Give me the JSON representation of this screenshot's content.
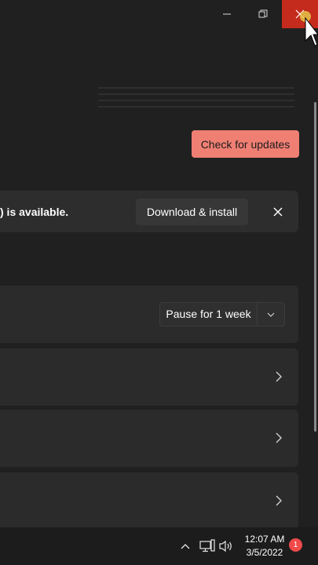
{
  "window": {
    "minimize_icon": "minimize-icon",
    "restore_icon": "restore-icon",
    "close_icon": "close-icon"
  },
  "header": {
    "check_updates_label": "Check for updates",
    "accent_color": "#f07f73"
  },
  "update_banner": {
    "text": ") is available.",
    "download_label": "Download & install",
    "dismiss_icon": "close-icon"
  },
  "pause": {
    "selected": "Pause for 1 week"
  },
  "taskbar": {
    "time": "12:07 AM",
    "date": "3/5/2022",
    "notification_count": "1"
  },
  "colors": {
    "background": "#202020",
    "card": "#2b2b2b",
    "close_hover": "#c42b1c",
    "badge": "#f04a4a"
  }
}
